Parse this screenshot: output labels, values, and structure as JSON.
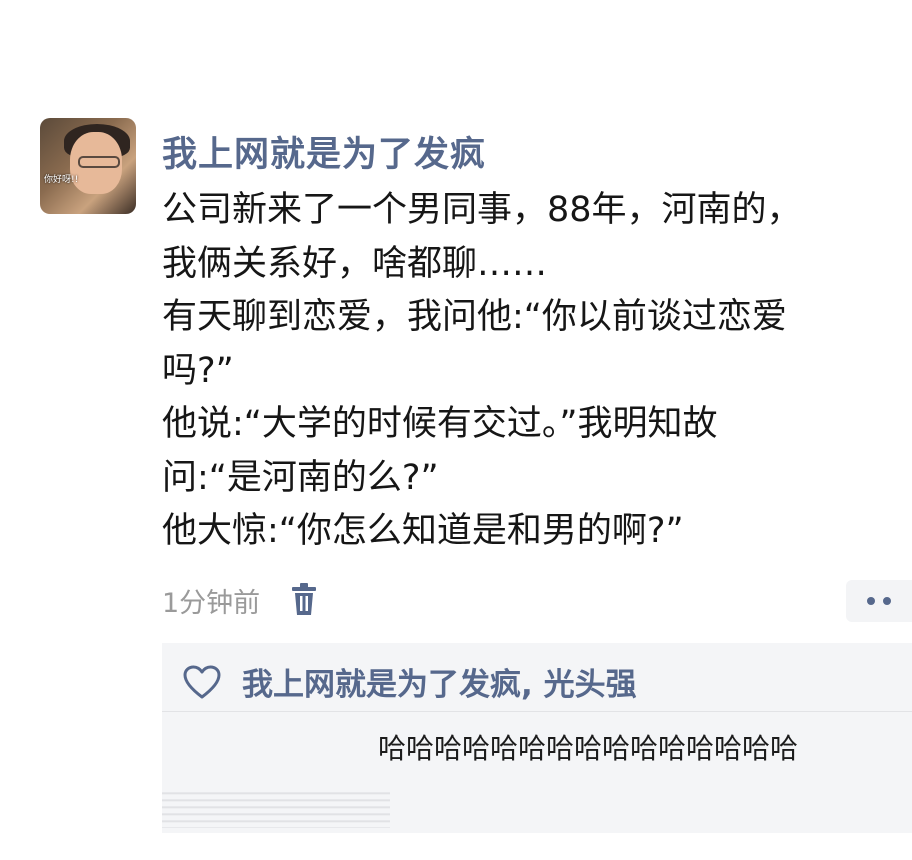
{
  "post": {
    "username": "我上网就是为了发疯",
    "avatar_caption": "你好呀!!",
    "lines": [
      "公司新来了一个男同事，88年，河南的，",
      "我俩关系好，啥都聊……",
      "有天聊到恋爱，我问他:“你以前谈过恋爱",
      "吗?”",
      "他说:“大学的时候有交过。”我明知故",
      "问:“是河南的么?”",
      "他大惊:“你怎么知道是和男的啊?”"
    ],
    "timestamp": "1分钟前",
    "delete_icon": "trash-icon",
    "more_icon": "more-dots-icon"
  },
  "interactions": {
    "like_icon": "heart-icon",
    "likers": "我上网就是为了发疯, 光头强",
    "comment_text": "哈哈哈哈哈哈哈哈哈哈哈哈哈哈哈"
  },
  "colors": {
    "name_blue": "#56688c",
    "text": "#161616",
    "muted": "#9a9a9a",
    "panel_bg": "#f4f5f7"
  }
}
